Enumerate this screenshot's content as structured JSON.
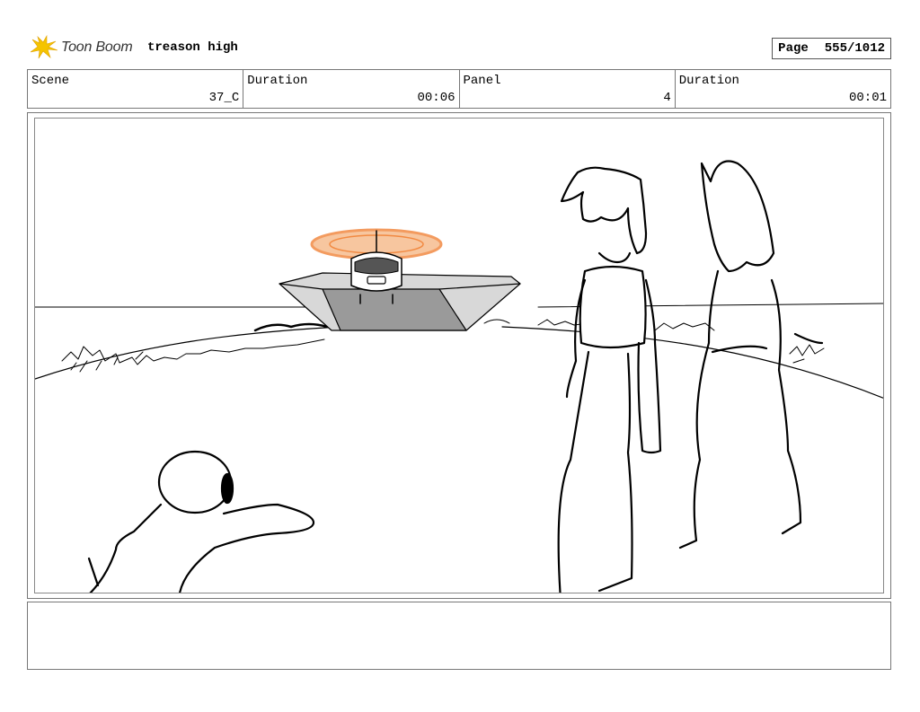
{
  "header": {
    "brand": "Toon Boom",
    "brand_icon": "toon-boom-logo-icon",
    "project_title": "treason high",
    "page_label": "Page",
    "page_value": "555/1012"
  },
  "info": {
    "scene_label": "Scene",
    "scene_value": "37_C",
    "scene_duration_label": "Duration",
    "scene_duration_value": "00:06",
    "panel_label": "Panel",
    "panel_value": "4",
    "panel_duration_label": "Duration",
    "panel_duration_value": "00:01"
  },
  "panel": {
    "illustration": "storyboard-sketch",
    "accent_color": "#f07a2a"
  },
  "notes": {
    "text": ""
  }
}
